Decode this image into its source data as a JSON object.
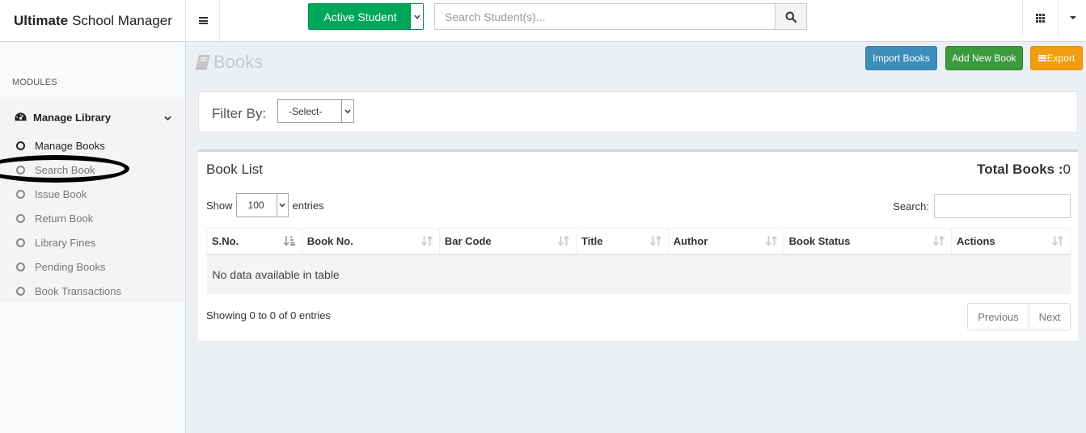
{
  "app": {
    "brand_bold": "Ultimate",
    "brand_rest": "School Manager"
  },
  "header": {
    "student_select": "Active Student",
    "search_placeholder": "Search Student(s)..."
  },
  "sidebar": {
    "section_label": "MODULES",
    "group": "Manage Library",
    "items": [
      {
        "label": "Manage Books",
        "active": true
      },
      {
        "label": "Search Book"
      },
      {
        "label": "Issue Book"
      },
      {
        "label": "Return Book"
      },
      {
        "label": "Library Fines"
      },
      {
        "label": "Pending Books"
      },
      {
        "label": "Book Transactions"
      }
    ]
  },
  "page": {
    "title": "Books",
    "buttons": {
      "import": "Import Books",
      "add": "Add New Book",
      "export": "Export"
    }
  },
  "filter": {
    "label": "Filter By:",
    "selected": "-Select-"
  },
  "book_list": {
    "title": "Book List",
    "total_label": "Total Books :",
    "total_value": "0",
    "show_label": "Show",
    "page_length": "100",
    "entries_label": "entries",
    "search_label": "Search:",
    "columns": [
      "S.No.",
      "Book No.",
      "Bar Code",
      "Title",
      "Author",
      "Book Status",
      "Actions"
    ],
    "empty_text": "No data available in table",
    "info": "Showing 0 to 0 of 0 entries",
    "pager": {
      "previous": "Previous",
      "next": "Next"
    }
  },
  "colors": {
    "green": "#00a65a",
    "blue": "#3c8dbc",
    "orange": "#f39c12",
    "add_green": "#3b9a3b"
  },
  "icons": [
    "hamburger-icon",
    "chevron-down-icon",
    "search-icon",
    "apps-grid-icon",
    "caret-down-icon",
    "dashboard-icon",
    "book-icon",
    "sort-icon"
  ]
}
